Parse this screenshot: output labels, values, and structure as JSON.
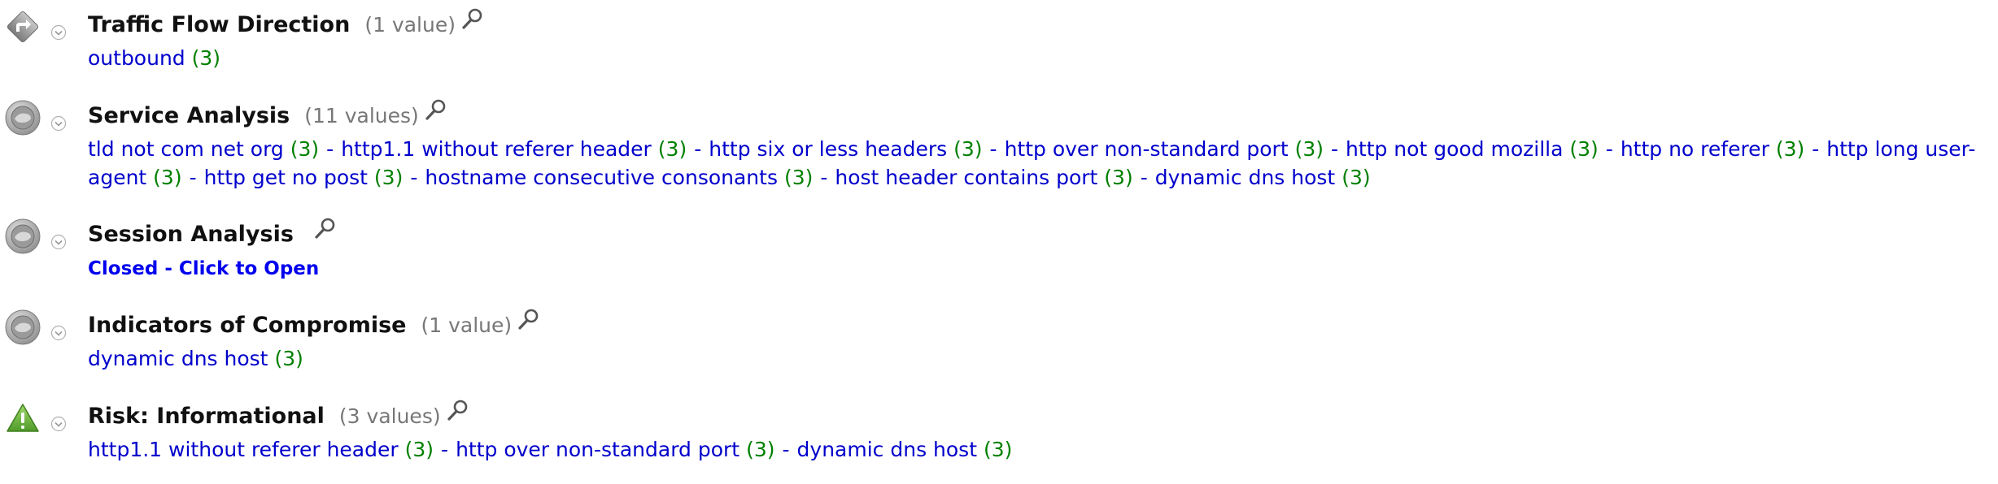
{
  "sections": [
    {
      "icon": "arrow-diamond-icon",
      "title": "Traffic Flow Direction",
      "count_label": "(1 value)",
      "values": [
        {
          "label": "outbound",
          "count": "(3)"
        }
      ]
    },
    {
      "icon": "gray-badge-icon",
      "title": "Service Analysis",
      "count_label": "(11 values)",
      "values": [
        {
          "label": "tld not com net org",
          "count": "(3)"
        },
        {
          "label": "http1.1 without referer header",
          "count": "(3)"
        },
        {
          "label": "http six or less headers",
          "count": "(3)"
        },
        {
          "label": "http over non-standard port",
          "count": "(3)"
        },
        {
          "label": "http not good mozilla",
          "count": "(3)"
        },
        {
          "label": "http no referer",
          "count": "(3)"
        },
        {
          "label": "http long user-agent",
          "count": "(3)"
        },
        {
          "label": "http get no post",
          "count": "(3)"
        },
        {
          "label": "hostname consecutive consonants",
          "count": "(3)"
        },
        {
          "label": "host header contains port",
          "count": "(3)"
        },
        {
          "label": "dynamic dns host",
          "count": "(3)"
        }
      ]
    },
    {
      "icon": "gray-badge-icon",
      "title": "Session Analysis",
      "count_label": "",
      "closed_text": "Closed - Click to Open"
    },
    {
      "icon": "gray-badge-icon",
      "title": "Indicators of Compromise",
      "count_label": "(1 value)",
      "values": [
        {
          "label": "dynamic dns host",
          "count": "(3)"
        }
      ]
    },
    {
      "icon": "warning-triangle-icon",
      "title": "Risk: Informational",
      "count_label": "(3 values)",
      "values": [
        {
          "label": "http1.1 without referer header",
          "count": "(3)"
        },
        {
          "label": "http over non-standard port",
          "count": "(3)"
        },
        {
          "label": "dynamic dns host",
          "count": "(3)"
        }
      ]
    }
  ],
  "separator": "-",
  "colors": {
    "link": "#0000cc",
    "count": "#008000",
    "muted": "#777777",
    "warning": "#6db33f"
  }
}
